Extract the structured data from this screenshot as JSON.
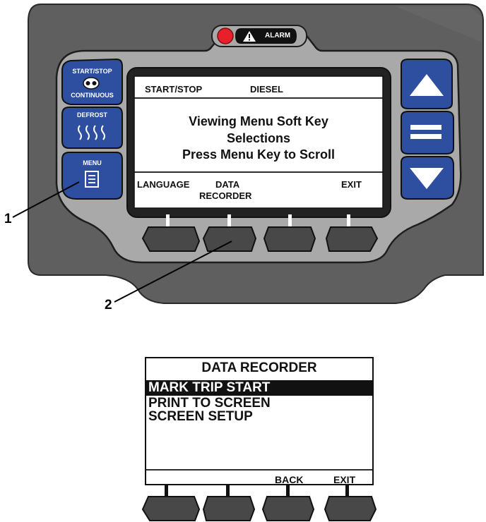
{
  "alarm": {
    "label": "ALARM"
  },
  "hardkeys": {
    "start_stop_label": "START/STOP",
    "continuous_label": "CONTINUOUS",
    "defrost_label": "DEFROST",
    "menu_label": "MENU"
  },
  "display": {
    "mode": "START/STOP",
    "fuel": "DIESEL",
    "message_lines": [
      "Viewing Menu Soft Key",
      "Selections",
      "Press Menu Key to Scroll"
    ],
    "softkeys": [
      "LANGUAGE",
      "DATA",
      "RECORDER",
      "EXIT"
    ]
  },
  "callouts": {
    "menu_key": "1",
    "soft_key": "2"
  },
  "data_recorder": {
    "title": "DATA RECORDER",
    "items": [
      "MARK TRIP START",
      "PRINT TO SCREEN",
      "SCREEN SETUP"
    ],
    "selected_index": 0,
    "softkeys": [
      "BACK",
      "EXIT"
    ]
  },
  "colors": {
    "housing": "#5f5f5f",
    "bezel": "#a9a9a9",
    "key_blue": "#2e4fa0",
    "alarm_led": "#e8202a",
    "lcd_bg": "#ffffff"
  }
}
